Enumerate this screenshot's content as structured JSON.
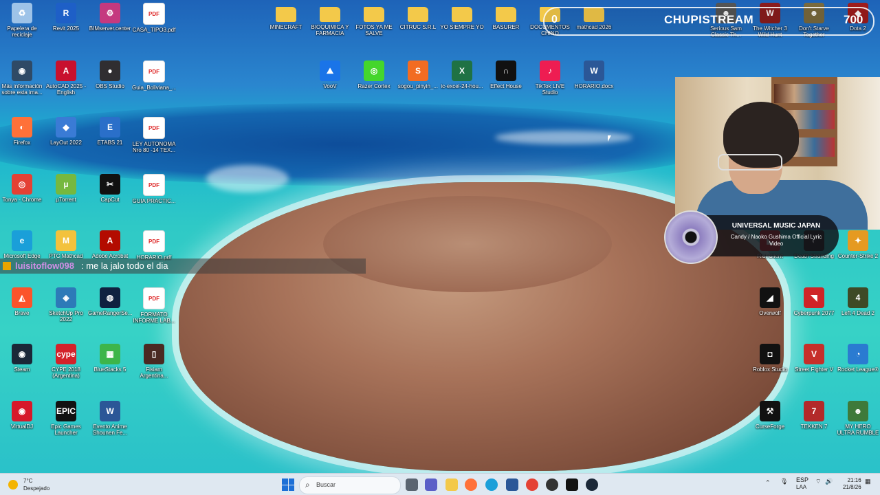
{
  "desktop": {
    "icons_left": [
      {
        "label": "Papelera de reciclaje",
        "kind": "recycle",
        "color": "#9ec3e8"
      },
      {
        "label": "Revit 2025",
        "kind": "app",
        "glyph": "R",
        "color": "#1e5fc7"
      },
      {
        "label": "BIMserver.center",
        "kind": "app",
        "glyph": "⚙",
        "color": "#c5397f"
      },
      {
        "label": "CASA_TIPO3.pdf",
        "kind": "pdf",
        "glyph": "PDF",
        "color": "#ffffff"
      },
      {
        "label": "Más información sobre esta ima...",
        "kind": "app",
        "glyph": "◉",
        "color": "#2f4a66"
      },
      {
        "label": "AutoCAD 2025 - English",
        "kind": "app",
        "glyph": "A",
        "color": "#c8102e"
      },
      {
        "label": "OBS Studio",
        "kind": "app",
        "glyph": "●",
        "color": "#302e31"
      },
      {
        "label": "Guia_Boliviana_...",
        "kind": "pdf",
        "glyph": "PDF",
        "color": "#ffffff"
      },
      {
        "label": "Firefox",
        "kind": "app",
        "glyph": "◐",
        "color": "#ff7139"
      },
      {
        "label": "LayOut 2022",
        "kind": "app",
        "glyph": "◆",
        "color": "#3a7bd5"
      },
      {
        "label": "ETABS 21",
        "kind": "app",
        "glyph": "E",
        "color": "#2a6fc9"
      },
      {
        "label": "LEY AUTONOMA Nro 80 -14 TEX...",
        "kind": "pdf",
        "glyph": "PDF",
        "color": "#ffffff"
      },
      {
        "label": "Tonya - Chrome",
        "kind": "app",
        "glyph": "◎",
        "color": "#e44134"
      },
      {
        "label": "µTorrent",
        "kind": "app",
        "glyph": "µ",
        "color": "#76b83f"
      },
      {
        "label": "CapCut",
        "kind": "app",
        "glyph": "✂",
        "color": "#111111"
      },
      {
        "label": "GUIA PRACTIC...",
        "kind": "pdf",
        "glyph": "PDF",
        "color": "#ffffff"
      },
      {
        "label": "Microsoft Edge",
        "kind": "app",
        "glyph": "e",
        "color": "#1a9fd9"
      },
      {
        "label": "PTC Mathcad",
        "kind": "app",
        "glyph": "M",
        "color": "#f3c23d"
      },
      {
        "label": "Adobe Acrobat",
        "kind": "app",
        "glyph": "A",
        "color": "#b30b00"
      },
      {
        "label": "HORARIO.pdf",
        "kind": "pdf",
        "glyph": "PDF",
        "color": "#ffffff"
      },
      {
        "label": "Brave",
        "kind": "app",
        "glyph": "◭",
        "color": "#fb542b"
      },
      {
        "label": "SketchUp Pro 2022",
        "kind": "app",
        "glyph": "◈",
        "color": "#2d7ab8"
      },
      {
        "label": "GameRangerSe...",
        "kind": "app",
        "glyph": "◍",
        "color": "#0f2140"
      },
      {
        "label": "FORMATO INFORME LAB...",
        "kind": "pdf",
        "glyph": "PDF",
        "color": "#ffffff"
      },
      {
        "label": "Steam",
        "kind": "app",
        "glyph": "◉",
        "color": "#1b2838"
      },
      {
        "label": "CYPE 2018 (Argentina)",
        "kind": "app",
        "glyph": "cype",
        "color": "#d3222a"
      },
      {
        "label": "BlueStacks 5",
        "kind": "app",
        "glyph": "▦",
        "color": "#3db54a"
      },
      {
        "label": "Fisiam Argentina...",
        "kind": "app",
        "glyph": "▯",
        "color": "#4a2a22"
      },
      {
        "label": "VirtualDJ",
        "kind": "app",
        "glyph": "◉",
        "color": "#d6182a"
      },
      {
        "label": "Epic Games Launcher",
        "kind": "app",
        "glyph": "EPIC",
        "color": "#121212"
      },
      {
        "label": "Evento Anime Shounen Fe...",
        "kind": "app",
        "glyph": "W",
        "color": "#2b5797"
      }
    ],
    "icons_top": [
      {
        "label": "MINECRAFT",
        "kind": "folder"
      },
      {
        "label": "BIOQUIMICA Y FARMACIA",
        "kind": "folder"
      },
      {
        "label": "FOTOS YA ME SALVE",
        "kind": "folder"
      },
      {
        "label": "CITRUC S.R.L",
        "kind": "folder"
      },
      {
        "label": "YO SIEMPRE YO",
        "kind": "folder"
      },
      {
        "label": "BASURER",
        "kind": "folder"
      },
      {
        "label": "DOCUMENTOS CHINO",
        "kind": "folder"
      },
      {
        "label": "mathcad 2026",
        "kind": "folder"
      }
    ],
    "icons_second_row": [
      {
        "label": "VooV",
        "glyph": "⛰",
        "color": "#1a74e8"
      },
      {
        "label": "Razer Cortex",
        "glyph": "◎",
        "color": "#44d62c"
      },
      {
        "label": "sogou_pinyin_...",
        "glyph": "S",
        "color": "#f26c22"
      },
      {
        "label": "ic-excel-24-hou...",
        "glyph": "X",
        "color": "#1f7244"
      },
      {
        "label": "Effect House",
        "glyph": "∩",
        "color": "#111111"
      },
      {
        "label": "TikTok LIVE Studio",
        "glyph": "♪",
        "color": "#ee1d52"
      },
      {
        "label": "HORARIO.docx",
        "glyph": "W",
        "color": "#2b5797"
      }
    ],
    "icons_right": [
      {
        "label": "Serious Sam Classic Th...",
        "glyph": "☻",
        "color": "#555555"
      },
      {
        "label": "The Witcher 3 Wild Hunt",
        "glyph": "W",
        "color": "#8a1c1c"
      },
      {
        "label": "Don't Starve Together",
        "glyph": "☻",
        "color": "#7a6a3d"
      },
      {
        "label": "Dota 2",
        "glyph": "◆",
        "color": "#9e1c1c"
      },
      {
        "label": "Riot Client",
        "glyph": "◣",
        "color": "#d13639"
      },
      {
        "label": "Death Stranding",
        "glyph": "◐",
        "color": "#333333"
      },
      {
        "label": "Counter-Strike 2",
        "glyph": "✦",
        "color": "#e59a21"
      },
      {
        "label": "Overwolf",
        "glyph": "◢",
        "color": "#111111"
      },
      {
        "label": "Cyberpunk 2077",
        "glyph": "◥",
        "color": "#cf2427"
      },
      {
        "label": "Left 4 Dead 2",
        "glyph": "4",
        "color": "#3e4a26"
      },
      {
        "label": "Roblox Studio",
        "glyph": "◘",
        "color": "#111111"
      },
      {
        "label": "Street Fighter V",
        "glyph": "V",
        "color": "#c62f2a"
      },
      {
        "label": "Rocket League®",
        "glyph": "◔",
        "color": "#2a7bd1"
      },
      {
        "label": "CurseForge",
        "glyph": "⚒",
        "color": "#111111"
      },
      {
        "label": "TEKKEN 7",
        "glyph": "7",
        "color": "#b32a2a"
      },
      {
        "label": "MY HERO ULTRA RUMBLE",
        "glyph": "☻",
        "color": "#3e7a3a"
      }
    ]
  },
  "overlay": {
    "stream_name": "CHUPISTREAM",
    "left_count": "0",
    "right_count": "700",
    "music_artist": "UNIVERSAL MUSIC JAPAN",
    "music_track": "Candy / Naoko Gushima Official Lyric Video",
    "chat_user": "luisitoflow098",
    "chat_message": ": me la jalo todo el dia"
  },
  "taskbar": {
    "weather_temp": "7°C",
    "weather_desc": "Despejado",
    "search_placeholder": "Buscar",
    "language": "ESP",
    "language_sub": "LAA",
    "time": "21:16",
    "date": "21/8/26"
  }
}
